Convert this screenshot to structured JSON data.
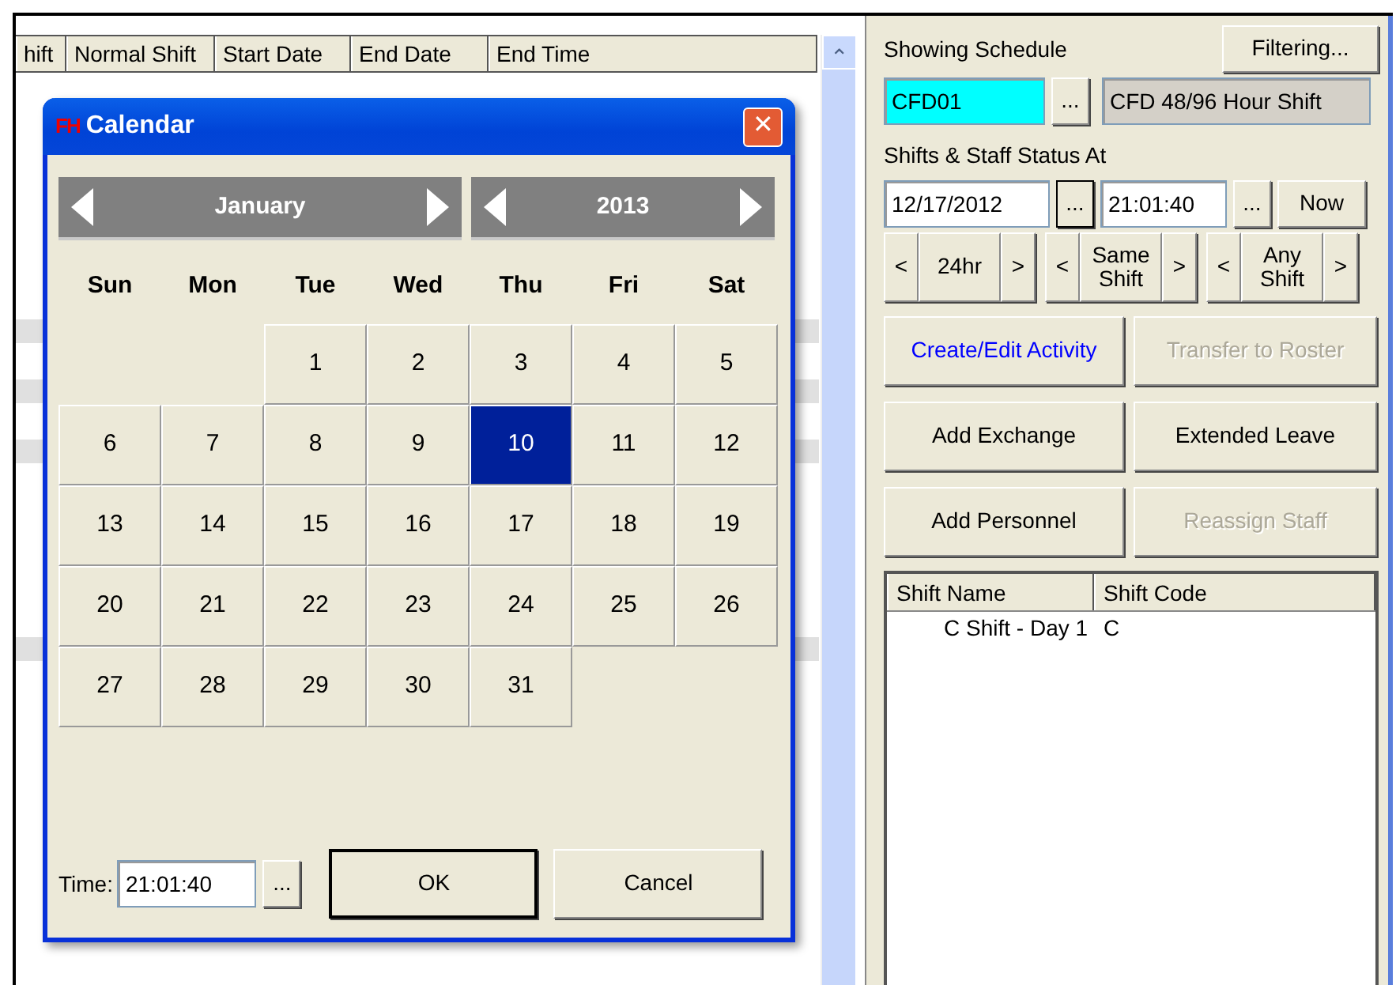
{
  "table": {
    "columns": [
      "hift",
      "Normal Shift",
      "Start Date",
      "End Date",
      "End Time"
    ],
    "scroll_up": "⌃"
  },
  "dialog": {
    "logo": "FH",
    "title": "Calendar",
    "close": "✕",
    "month": "January",
    "year": "2013",
    "weekdays": [
      "Sun",
      "Mon",
      "Tue",
      "Wed",
      "Thu",
      "Fri",
      "Sat"
    ],
    "weeks": [
      [
        {
          "kind": "blank"
        },
        {
          "kind": "blank"
        },
        {
          "label": "1",
          "selected": false
        },
        {
          "label": "2",
          "selected": false
        },
        {
          "label": "3",
          "selected": false
        },
        {
          "label": "4",
          "selected": false
        },
        {
          "label": "5",
          "selected": false
        }
      ],
      [
        {
          "label": "6",
          "selected": false
        },
        {
          "label": "7",
          "selected": false
        },
        {
          "label": "8",
          "selected": false
        },
        {
          "label": "9",
          "selected": false
        },
        {
          "label": "10",
          "selected": true
        },
        {
          "label": "11",
          "selected": false
        },
        {
          "label": "12",
          "selected": false
        }
      ],
      [
        {
          "label": "13",
          "selected": false
        },
        {
          "label": "14",
          "selected": false
        },
        {
          "label": "15",
          "selected": false
        },
        {
          "label": "16",
          "selected": false
        },
        {
          "label": "17",
          "selected": false
        },
        {
          "label": "18",
          "selected": false
        },
        {
          "label": "19",
          "selected": false
        }
      ],
      [
        {
          "label": "20",
          "selected": false
        },
        {
          "label": "21",
          "selected": false
        },
        {
          "label": "22",
          "selected": false
        },
        {
          "label": "23",
          "selected": false
        },
        {
          "label": "24",
          "selected": false
        },
        {
          "label": "25",
          "selected": false
        },
        {
          "label": "26",
          "selected": false
        }
      ],
      [
        {
          "label": "27",
          "selected": false
        },
        {
          "label": "28",
          "selected": false
        },
        {
          "label": "29",
          "selected": false
        },
        {
          "label": "30",
          "selected": false
        },
        {
          "label": "31",
          "selected": false
        },
        {
          "kind": "blank"
        },
        {
          "kind": "blank"
        }
      ]
    ],
    "time_label": "Time:",
    "time_value": "21:01:40",
    "time_picker": "...",
    "ok": "OK",
    "cancel": "Cancel"
  },
  "panel": {
    "schedule_label": "Showing Schedule",
    "filter_button": "Filtering...",
    "schedule_code": {
      "value": "CFD01",
      "highlighted": true
    },
    "schedule_picker": "...",
    "schedule_name": "CFD 48/96 Hour Shift",
    "status_label": "Shifts & Staff Status At",
    "date_value": "12/17/2012",
    "date_picker": "...",
    "time_value": "21:01:40",
    "time_picker": "...",
    "now_button": "Now",
    "steppers": [
      {
        "prev": "<",
        "label": "24hr",
        "next": ">"
      },
      {
        "prev": "<",
        "label": "Same Shift",
        "next": ">"
      },
      {
        "prev": "<",
        "label": "Any Shift",
        "next": ">"
      }
    ],
    "actions": [
      {
        "label": "Create/Edit Activity",
        "highlighted": true,
        "disabled": false
      },
      {
        "label": "Transfer to Roster",
        "highlighted": false,
        "disabled": true
      },
      {
        "label": "Add Exchange",
        "highlighted": false,
        "disabled": false
      },
      {
        "label": "Extended Leave",
        "highlighted": false,
        "disabled": false
      },
      {
        "label": "Add Personnel",
        "highlighted": false,
        "disabled": false
      },
      {
        "label": "Reassign Staff",
        "highlighted": false,
        "disabled": true
      }
    ],
    "shift_list": {
      "columns": [
        "Shift Name",
        "Shift Code"
      ],
      "rows": [
        [
          "C Shift - Day 1",
          "C"
        ]
      ]
    }
  }
}
